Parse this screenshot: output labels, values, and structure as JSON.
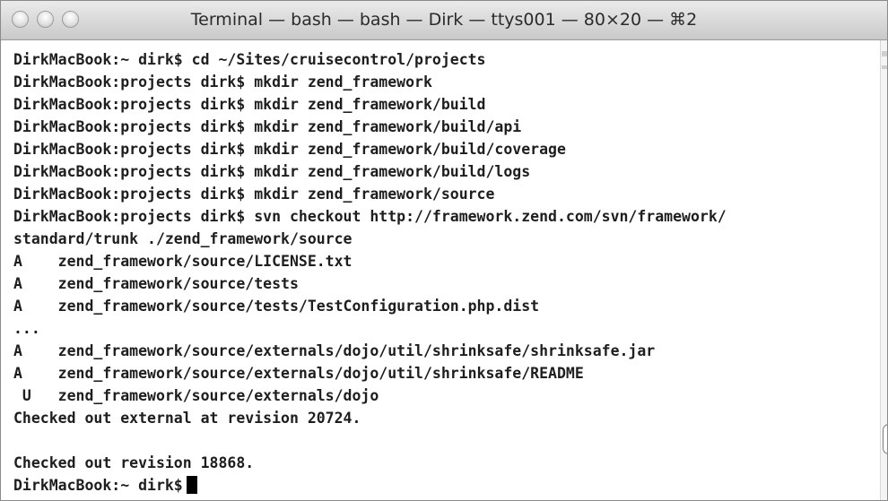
{
  "window": {
    "title": "Terminal — bash — bash — Dirk — ttys001 — 80×20 — ⌘2"
  },
  "terminal": {
    "lines": [
      "DirkMacBook:~ dirk$ cd ~/Sites/cruisecontrol/projects",
      "DirkMacBook:projects dirk$ mkdir zend_framework",
      "DirkMacBook:projects dirk$ mkdir zend_framework/build",
      "DirkMacBook:projects dirk$ mkdir zend_framework/build/api",
      "DirkMacBook:projects dirk$ mkdir zend_framework/build/coverage",
      "DirkMacBook:projects dirk$ mkdir zend_framework/build/logs",
      "DirkMacBook:projects dirk$ mkdir zend_framework/source",
      "DirkMacBook:projects dirk$ svn checkout http://framework.zend.com/svn/framework/",
      "standard/trunk ./zend_framework/source",
      "A    zend_framework/source/LICENSE.txt",
      "A    zend_framework/source/tests",
      "A    zend_framework/source/tests/TestConfiguration.php.dist",
      "...",
      "A    zend_framework/source/externals/dojo/util/shrinksafe/shrinksafe.jar",
      "A    zend_framework/source/externals/dojo/util/shrinksafe/README",
      " U   zend_framework/source/externals/dojo",
      "Checked out external at revision 20724.",
      "",
      "Checked out revision 18868.",
      "DirkMacBook:~ dirk$"
    ]
  }
}
